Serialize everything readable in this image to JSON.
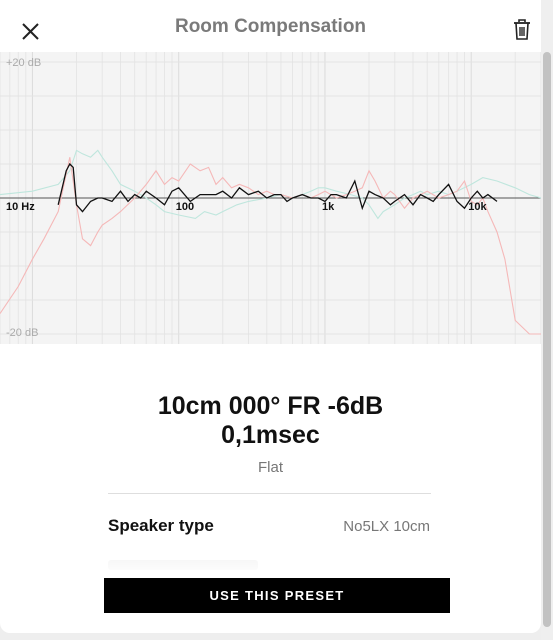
{
  "header": {
    "title": "Room Compensation",
    "close_icon": "close-icon",
    "delete_icon": "trash-icon"
  },
  "chart_data": {
    "type": "line",
    "title": "",
    "xscale": "log",
    "xlim": [
      6,
      30000
    ],
    "ylim": [
      -20,
      20
    ],
    "y_labels": [
      "+20 dB",
      "-20 dB"
    ],
    "x_tick_labels": [
      {
        "value": 10,
        "label": "10 Hz"
      },
      {
        "value": 100,
        "label": "100"
      },
      {
        "value": 1000,
        "label": "1k"
      },
      {
        "value": 10000,
        "label": "10k"
      }
    ],
    "grid": true,
    "series": [
      {
        "color": "#bfe6dd",
        "x": [
          6,
          10,
          15,
          18,
          20,
          22,
          25,
          28,
          30,
          35,
          40,
          50,
          60,
          70,
          80,
          100,
          130,
          150,
          180,
          200,
          250,
          300,
          400,
          500,
          600,
          700,
          800,
          900,
          1000,
          1200,
          1500,
          1800,
          2000,
          2300,
          2500,
          3000,
          3500,
          4000,
          4500,
          5000,
          6000,
          7000,
          8000,
          10000,
          12000,
          15000,
          20000,
          25000,
          30000
        ],
        "y": [
          0.5,
          1,
          2,
          4,
          7,
          6.5,
          6,
          7,
          6,
          4,
          2,
          1,
          0,
          -1,
          -2,
          -2.5,
          -3,
          -2,
          -2.5,
          -2,
          -1,
          -0.5,
          0,
          0.5,
          0,
          0.5,
          1,
          1.5,
          1.5,
          1,
          0.5,
          0,
          -1,
          -3,
          -2,
          -1,
          0,
          0.5,
          1,
          0.5,
          1,
          0.5,
          1,
          2,
          3,
          2.5,
          1.5,
          0.5,
          0
        ]
      },
      {
        "color": "#f5b8b8",
        "x": [
          6,
          8,
          10,
          12,
          15,
          18,
          20,
          22,
          25,
          28,
          30,
          35,
          40,
          50,
          60,
          70,
          80,
          90,
          100,
          120,
          140,
          160,
          180,
          200,
          230,
          260,
          300,
          350,
          400,
          450,
          500,
          600,
          700,
          800,
          900,
          1000,
          1200,
          1400,
          1600,
          1800,
          2000,
          2200,
          2500,
          2800,
          3000,
          3500,
          4000,
          4500,
          5000,
          6000,
          7000,
          8000,
          9000,
          10000,
          11000,
          12000,
          13000,
          15000,
          17000,
          20000,
          25000,
          30000
        ],
        "y": [
          -17,
          -13,
          -9,
          -6,
          -2,
          6,
          -1,
          -6,
          -7,
          -5,
          -4,
          -3,
          -2,
          0,
          2,
          4,
          2,
          3,
          2.5,
          5,
          4,
          4.5,
          2,
          3,
          1.5,
          2,
          1.5,
          0.5,
          1,
          0.5,
          0.5,
          0,
          0.5,
          0,
          0.5,
          1,
          0,
          0.5,
          1,
          1.5,
          4,
          2.5,
          0,
          1,
          0.5,
          -1.5,
          0,
          0.5,
          1,
          0,
          0.5,
          1,
          2.5,
          -0.5,
          -1,
          0,
          -2,
          -5,
          -9,
          -18,
          -20,
          -20
        ]
      },
      {
        "color": "#111111",
        "x": [
          15,
          17,
          18,
          19,
          20,
          22,
          25,
          28,
          30,
          35,
          40,
          45,
          50,
          55,
          60,
          70,
          80,
          90,
          100,
          120,
          140,
          160,
          180,
          200,
          230,
          260,
          300,
          350,
          400,
          450,
          500,
          550,
          600,
          700,
          800,
          900,
          1000,
          1100,
          1200,
          1400,
          1600,
          1800,
          2000,
          2200,
          2500,
          2800,
          3000,
          3500,
          4000,
          4500,
          5000,
          5500,
          6000,
          7000,
          8000,
          9000,
          10000,
          11000,
          12000,
          13000,
          15000
        ],
        "y": [
          -1,
          4,
          5,
          4.5,
          -1,
          -2,
          -0.5,
          0,
          0,
          -0.5,
          1,
          -0.5,
          0.5,
          0,
          1,
          0,
          -1,
          1,
          1.5,
          -0.5,
          0.5,
          0.5,
          0.5,
          1,
          0,
          1.5,
          0.5,
          1,
          0,
          0.5,
          0.5,
          -0.5,
          0,
          0.5,
          0,
          0,
          -0.5,
          0.5,
          0.5,
          0,
          2.5,
          -1.5,
          1,
          0.5,
          0,
          -1,
          -0.5,
          0.5,
          -1,
          0.5,
          0,
          -0.5,
          0.5,
          2,
          -0.5,
          -1.5,
          0,
          1,
          0,
          0.5,
          -0.5
        ]
      }
    ]
  },
  "preset": {
    "name_line1": "10cm 000° FR -6dB",
    "name_line2": "0,1msec",
    "mode": "Flat"
  },
  "specs": {
    "speaker_type_label": "Speaker type",
    "speaker_type_value": "No5LX 10cm"
  },
  "actions": {
    "use_preset_label": "USE THIS PRESET"
  }
}
